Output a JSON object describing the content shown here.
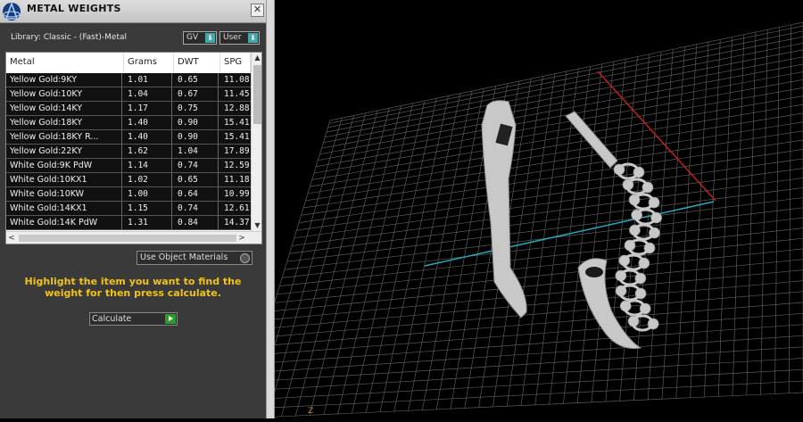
{
  "panel": {
    "title": "METAL WEIGHTS",
    "close_glyph": "✕",
    "library_label": "Library: Classic - (Fast)-Metal",
    "gv_label": "GV",
    "user_label": "User",
    "dropdown_glyph": "⬇"
  },
  "table": {
    "headers": [
      "Metal",
      "Grams",
      "DWT",
      "SPG"
    ],
    "rows": [
      [
        "Yellow Gold:9KY",
        "1.01",
        "0.65",
        "11.08"
      ],
      [
        "Yellow Gold:10KY",
        "1.04",
        "0.67",
        "11.45"
      ],
      [
        "Yellow Gold:14KY",
        "1.17",
        "0.75",
        "12.88"
      ],
      [
        "Yellow Gold:18KY",
        "1.40",
        "0.90",
        "15.41"
      ],
      [
        "Yellow Gold:18KY R...",
        "1.40",
        "0.90",
        "15.41"
      ],
      [
        "Yellow Gold:22KY",
        "1.62",
        "1.04",
        "17.89"
      ],
      [
        "White Gold:9K PdW",
        "1.14",
        "0.74",
        "12.59"
      ],
      [
        "White Gold:10KX1",
        "1.02",
        "0.65",
        "11.18"
      ],
      [
        "White Gold:10KW",
        "1.00",
        "0.64",
        "10.99"
      ],
      [
        "White Gold:14KX1",
        "1.15",
        "0.74",
        "12.61"
      ],
      [
        "White Gold:14K PdW",
        "1.31",
        "0.84",
        "14.37"
      ]
    ],
    "scroll_up": "▲",
    "scroll_down": "▼",
    "scroll_left": "<",
    "scroll_right": ">"
  },
  "controls": {
    "use_object_materials": "Use Object Materials",
    "hint": "Highlight the item you want to find the weight for then press calculate.",
    "calculate_label": "Calculate"
  },
  "viewport": {
    "axis_label": "Z",
    "colors": {
      "x_axis": "#c02020",
      "y_axis": "#2aa6b8",
      "grid": "#5a5a5a"
    }
  }
}
